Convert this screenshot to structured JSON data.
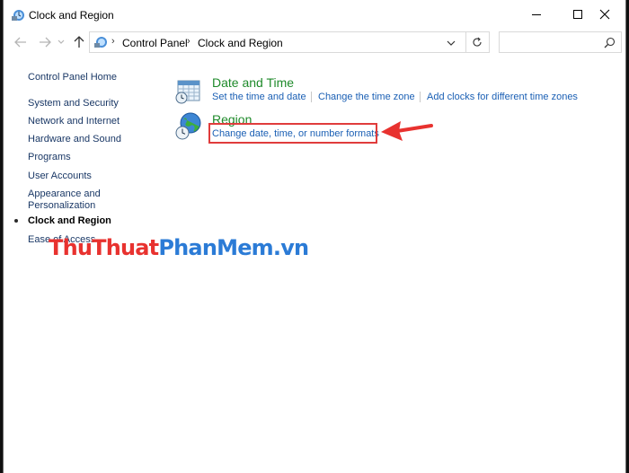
{
  "window": {
    "title": "Clock and Region"
  },
  "navigation": {
    "breadcrumb": [
      "Control Panel",
      "Clock and Region"
    ],
    "search_placeholder": ""
  },
  "sidebar": {
    "home": "Control Panel Home",
    "items": [
      {
        "label": "System and Security",
        "current": false
      },
      {
        "label": "Network and Internet",
        "current": false
      },
      {
        "label": "Hardware and Sound",
        "current": false
      },
      {
        "label": "Programs",
        "current": false
      },
      {
        "label": "User Accounts",
        "current": false
      },
      {
        "label": "Appearance and",
        "label2": "Personalization",
        "current": false
      },
      {
        "label": "Clock and Region",
        "current": true
      },
      {
        "label": "Ease of Access",
        "current": false
      }
    ]
  },
  "main": {
    "categories": [
      {
        "title": "Date and Time",
        "icon": "calendar-clock-icon",
        "tasks": [
          "Set the time and date",
          "Change the time zone",
          "Add clocks for different time zones"
        ]
      },
      {
        "title": "Region",
        "icon": "globe-clock-icon",
        "tasks": [
          "Change date, time, or number formats"
        ]
      }
    ]
  },
  "annotation": {
    "highlight_color": "#e03c3c",
    "arrow_color": "#e8322f"
  },
  "watermark": {
    "part1": "ThuThuat",
    "part2": "PhanMem",
    "part3": ".vn"
  },
  "colors": {
    "category_title": "#1e8a2a",
    "task_link": "#1a5fb4",
    "sidebar_link": "#1a3866"
  }
}
